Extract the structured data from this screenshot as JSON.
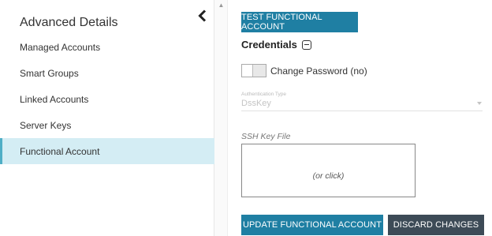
{
  "sidebar": {
    "title": "Advanced Details",
    "items": [
      {
        "label": "Managed Accounts"
      },
      {
        "label": "Smart Groups"
      },
      {
        "label": "Linked Accounts"
      },
      {
        "label": "Server Keys"
      },
      {
        "label": "Functional Account"
      }
    ],
    "active_item": "Functional Account",
    "collapse_icon": "chevron-left-icon"
  },
  "main": {
    "test_button_label": "TEST FUNCTIONAL ACCOUNT",
    "section_title": "Credentials",
    "section_icon": "collapse-minus-icon",
    "toggle_label": "Change Password (no)",
    "toggle_on": false,
    "auth_type_label": "Authentication Type",
    "auth_type_value": "DssKey",
    "ssh_key_label": "SSH Key File",
    "dropzone_text": "(or click)",
    "update_button_label": "UPDATE FUNCTIONAL ACCOUNT",
    "discard_button_label": "DISCARD CHANGES"
  },
  "colors": {
    "primary_button": "#1f7fa3",
    "dark_button": "#3d4b57",
    "active_nav_bg": "#d4edf4",
    "active_nav_border": "#4faec6"
  }
}
